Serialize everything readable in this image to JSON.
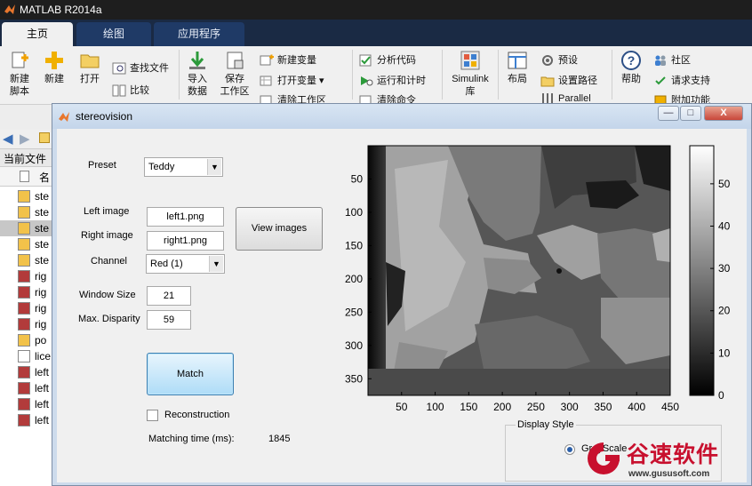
{
  "window": {
    "title": "MATLAB R2014a"
  },
  "tabs": [
    {
      "label": "主页"
    },
    {
      "label": "绘图"
    },
    {
      "label": "应用程序"
    }
  ],
  "ribbon": {
    "new_script": "新建\n脚本",
    "new": "新建",
    "open": "打开",
    "find_files": "查找文件",
    "compare": "比较",
    "import_data": "导入\n数据",
    "save_workspace": "保存\n工作区",
    "new_variable": "新建变量",
    "open_variable": "打开变量",
    "clear_workspace": "清除工作区",
    "analyze_code": "分析代码",
    "run_and_time": "运行和计时",
    "clear_commands": "清除命令",
    "simulink": "Simulink\n库",
    "layout": "布局",
    "preferences": "预设",
    "set_path": "设置路径",
    "parallel": "Parallel",
    "help": "帮助",
    "community": "社区",
    "request_support": "请求支持",
    "addons": "附加功能"
  },
  "left_panel": {
    "current_folder": "当前文件",
    "column_name": "名",
    "files": [
      {
        "name": "ste",
        "type": "m"
      },
      {
        "name": "ste",
        "type": "m"
      },
      {
        "name": "ste",
        "type": "m",
        "selected": true
      },
      {
        "name": "ste",
        "type": "m"
      },
      {
        "name": "ste",
        "type": "m"
      },
      {
        "name": "rig",
        "type": "png"
      },
      {
        "name": "rig",
        "type": "png"
      },
      {
        "name": "rig",
        "type": "png"
      },
      {
        "name": "rig",
        "type": "png"
      },
      {
        "name": "po",
        "type": "m"
      },
      {
        "name": "lice",
        "type": "txt"
      },
      {
        "name": "left",
        "type": "png"
      },
      {
        "name": "left",
        "type": "png"
      },
      {
        "name": "left",
        "type": "png"
      },
      {
        "name": "left",
        "type": "png"
      }
    ]
  },
  "figure": {
    "title": "stereovision",
    "controls_minimize": "—",
    "controls_maximize": "□",
    "controls_close": "X",
    "preset_label": "Preset",
    "preset_value": "Teddy",
    "left_image_label": "Left image",
    "left_image_value": "left1.png",
    "right_image_label": "Right image",
    "right_image_value": "right1.png",
    "channel_label": "Channel",
    "channel_value": "Red (1)",
    "view_images_button": "View images",
    "window_size_label": "Window Size",
    "window_size_value": "21",
    "max_disparity_label": "Max. Disparity",
    "max_disparity_value": "59",
    "match_button": "Match",
    "reconstruction_label": "Reconstruction",
    "matching_time_label": "Matching time (ms):",
    "matching_time_value": "1845",
    "display_style_label": "Display Style",
    "display_style_option": "GrayScale"
  },
  "disparity_plot": {
    "x_ticks": [
      50,
      100,
      150,
      200,
      250,
      300,
      350,
      400,
      450
    ],
    "y_ticks": [
      50,
      100,
      150,
      200,
      250,
      300,
      350
    ],
    "x_range": [
      0,
      450
    ],
    "y_range": [
      0,
      375
    ],
    "colorbar_ticks": [
      0,
      10,
      20,
      30,
      40,
      50
    ],
    "colorbar_range": [
      0,
      59
    ],
    "colormap": "gray"
  },
  "watermark": {
    "brand": "谷速软件",
    "url": "www.gususoft.com",
    "color": "#c8102e"
  }
}
